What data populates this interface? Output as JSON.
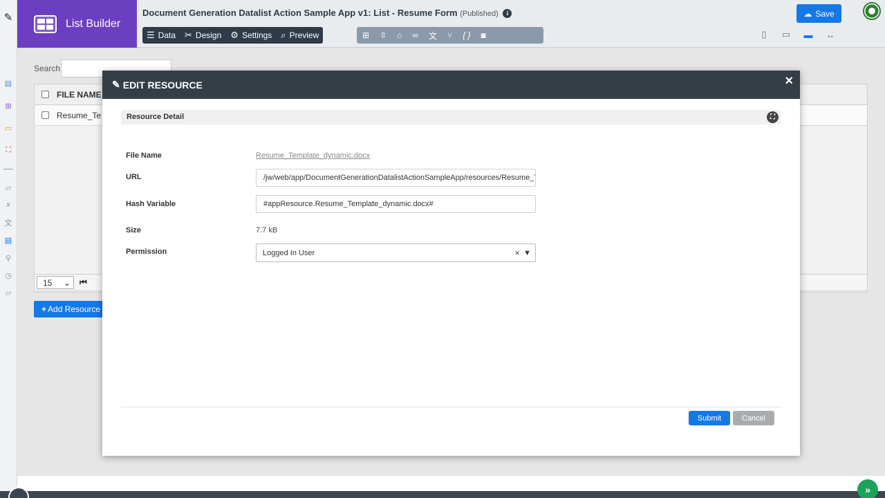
{
  "header": {
    "brand_title": "List Builder",
    "app_title": "Document Generation Datalist Action Sample App v1: List - Resume Form",
    "status": "(Published)",
    "info_glyph": "i",
    "nav": [
      {
        "label": "Data",
        "icon": "list-icon"
      },
      {
        "label": "Design",
        "icon": "tools-icon"
      },
      {
        "label": "Settings",
        "icon": "gear-icon"
      },
      {
        "label": "Preview",
        "icon": "preview-icon"
      }
    ],
    "tool_icons": [
      "sitemap-icon",
      "import-icon",
      "lock-icon",
      "glasses-icon",
      "translate-icon",
      "branch-icon",
      "json-icon",
      "camera-icon"
    ],
    "save_label": "Save",
    "device_icons": [
      "phone-icon",
      "tablet-icon",
      "laptop-icon",
      "resize-icon"
    ]
  },
  "background": {
    "search_label": "Search",
    "table_header": "FILE NAME",
    "row_value": "Resume_Te",
    "page_size": "15",
    "add_button": "Add Resource"
  },
  "modal": {
    "title": "EDIT RESOURCE",
    "close": "×",
    "section_title": "Resource Detail",
    "fields": {
      "file_name_label": "File Name",
      "file_name_value": "Resume_Template_dynamic.docx",
      "url_label": "URL",
      "url_value": "/jw/web/app/DocumentGenerationDatalistActionSampleApp/resources/Resume_T",
      "hash_label": "Hash Variable",
      "hash_value": "#appResource.Resume_Template_dynamic.docx#",
      "size_label": "Size",
      "size_value": "7.7 kB",
      "permission_label": "Permission",
      "permission_value": "Logged In User"
    },
    "submit_label": "Submit",
    "cancel_label": "Cancel"
  },
  "colors": {
    "brand": "#6c3fc0",
    "primary": "#1479e6",
    "modal_header": "#353d45",
    "nav_dark": "#2f3b48"
  }
}
